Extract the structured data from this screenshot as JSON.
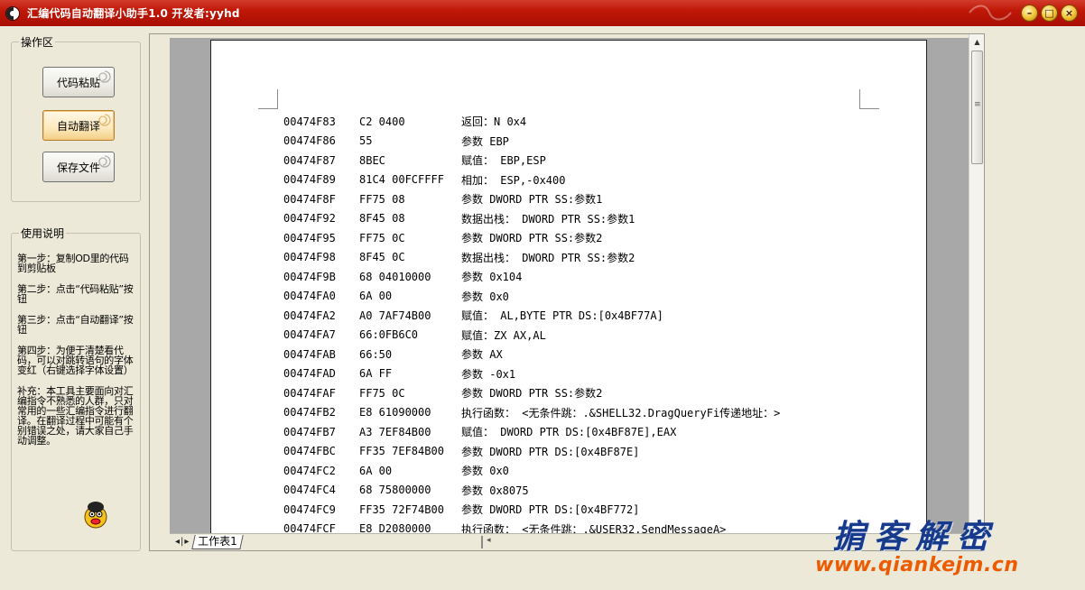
{
  "window": {
    "title": "汇编代码自动翻译小助手1.0  开发者:yyhd"
  },
  "operations": {
    "legend": "操作区",
    "paste_label": "代码粘贴",
    "translate_label": "自动翻译",
    "save_label": "保存文件"
  },
  "help": {
    "legend": "使用说明",
    "paragraphs": [
      "第一步：复制OD里的代码到剪贴板",
      "第二步：点击“代码粘贴”按钮",
      "第三步：点击“自动翻译”按钮",
      "第四步：为便于清楚看代码，可以对跳转语句的字体变红（右键选择字体设置）",
      "补充：本工具主要面向对汇编指令不熟悉的人群，只对常用的一些汇编指令进行翻译。在翻译过程中可能有个别错误之处，请大家自己手动调整。"
    ]
  },
  "code_rows": [
    [
      "00474F83",
      "C2 0400",
      "返回：N 0x4"
    ],
    [
      "00474F86",
      "55",
      "参数 EBP"
    ],
    [
      "00474F87",
      "8BEC",
      "赋值： EBP,ESP"
    ],
    [
      "00474F89",
      "81C4 00FCFFFF",
      "相加： ESP,-0x400"
    ],
    [
      "00474F8F",
      "FF75 08",
      "参数 DWORD PTR SS:参数1"
    ],
    [
      "00474F92",
      "8F45 08",
      "数据出栈： DWORD PTR SS:参数1"
    ],
    [
      "00474F95",
      "FF75 0C",
      "参数 DWORD PTR SS:参数2"
    ],
    [
      "00474F98",
      "8F45 0C",
      "数据出栈： DWORD PTR SS:参数2"
    ],
    [
      "00474F9B",
      "68 04010000",
      "参数 0x104"
    ],
    [
      "00474FA0",
      "6A 00",
      "参数 0x0"
    ],
    [
      "00474FA2",
      "A0 7AF74B00",
      "赋值： AL,BYTE PTR DS:[0x4BF77A]"
    ],
    [
      "00474FA7",
      "66:0FB6C0",
      "赋值：ZX AX,AL"
    ],
    [
      "00474FAB",
      "66:50",
      "参数 AX"
    ],
    [
      "00474FAD",
      "6A FF",
      "参数 -0x1"
    ],
    [
      "00474FAF",
      "FF75 0C",
      "参数 DWORD PTR SS:参数2"
    ],
    [
      "00474FB2",
      "E8 61090000",
      "执行函数： <无条件跳：.&SHELL32.DragQueryFi传递地址：>"
    ],
    [
      "00474FB7",
      "A3 7EF84B00",
      "赋值： DWORD PTR DS:[0x4BF87E],EAX"
    ],
    [
      "00474FBC",
      "FF35 7EF84B00",
      "参数 DWORD PTR DS:[0x4BF87E]"
    ],
    [
      "00474FC2",
      "6A 00",
      "参数 0x0"
    ],
    [
      "00474FC4",
      "68 75800000",
      "参数 0x8075"
    ],
    [
      "00474FC9",
      "FF35 72F74B00",
      "参数 DWORD PTR DS:[0x4BF772]"
    ],
    [
      "00474FCF",
      "E8 D2080000",
      "执行函数： <无条件跳：.&USER32.SendMessageA>"
    ]
  ],
  "sheet": {
    "nav": "◂|▸",
    "tab_label": "工作表1"
  },
  "watermark": {
    "title": "掮客解密",
    "url": "www.qiankejm.cn"
  }
}
